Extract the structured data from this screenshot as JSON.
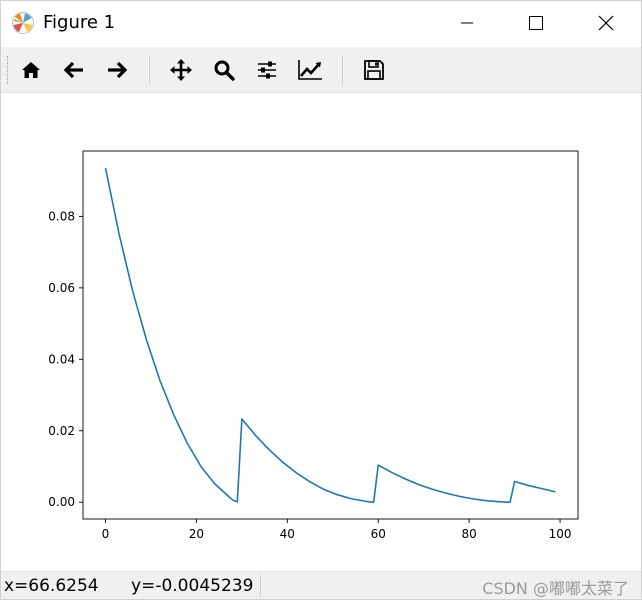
{
  "window": {
    "title": "Figure 1"
  },
  "toolbar": {
    "buttons": [
      {
        "name": "home",
        "icon": "home-icon"
      },
      {
        "name": "back",
        "icon": "arrow-left-icon"
      },
      {
        "name": "forward",
        "icon": "arrow-right-icon"
      },
      {
        "name": "pan",
        "icon": "move-icon"
      },
      {
        "name": "zoom",
        "icon": "search-icon"
      },
      {
        "name": "configure-subplots",
        "icon": "sliders-icon"
      },
      {
        "name": "edit-axis",
        "icon": "line-chart-icon"
      },
      {
        "name": "save",
        "icon": "floppy-disk-icon"
      }
    ]
  },
  "status": {
    "coordinates": "x=66.6254      y=-0.0045239",
    "watermark": "CSDN @嘟嘟太菜了"
  },
  "colors": {
    "line": "#1f77b4",
    "toolbar_bg": "#f0f0f0"
  },
  "chart_data": {
    "type": "line",
    "title": "",
    "xlabel": "",
    "ylabel": "",
    "xlim": [
      -4.95,
      103.95
    ],
    "ylim": [
      -0.0047,
      0.0983
    ],
    "xticks": [
      0,
      20,
      40,
      60,
      80,
      100
    ],
    "yticks": [
      0.0,
      0.02,
      0.04,
      0.06,
      0.08
    ],
    "xtick_labels": [
      "0",
      "20",
      "40",
      "60",
      "80",
      "100"
    ],
    "ytick_labels": [
      "0.00",
      "0.02",
      "0.04",
      "0.06",
      "0.08"
    ],
    "grid": false,
    "series": [
      {
        "x": [
          0,
          3,
          6,
          9,
          12,
          15,
          18,
          21,
          24,
          27,
          28,
          29,
          30,
          33,
          36,
          39,
          42,
          45,
          48,
          51,
          54,
          57,
          58,
          59,
          60,
          63,
          66,
          69,
          72,
          75,
          78,
          81,
          84,
          87,
          88,
          89,
          90,
          93,
          96,
          99
        ],
        "y": [
          0.0935,
          0.075,
          0.059,
          0.0455,
          0.034,
          0.0245,
          0.0165,
          0.01,
          0.0052,
          0.0017,
          0.0006,
          0.0001,
          0.0233,
          0.0187,
          0.0147,
          0.0112,
          0.0082,
          0.0057,
          0.0036,
          0.0021,
          0.001,
          0.0003,
          0.0001,
          0.0,
          0.0104,
          0.0083,
          0.0065,
          0.0049,
          0.0036,
          0.0025,
          0.0016,
          0.0009,
          0.0004,
          0.0001,
          0.0,
          0.0,
          0.0058,
          0.0047,
          0.0038,
          0.0029
        ]
      }
    ]
  }
}
